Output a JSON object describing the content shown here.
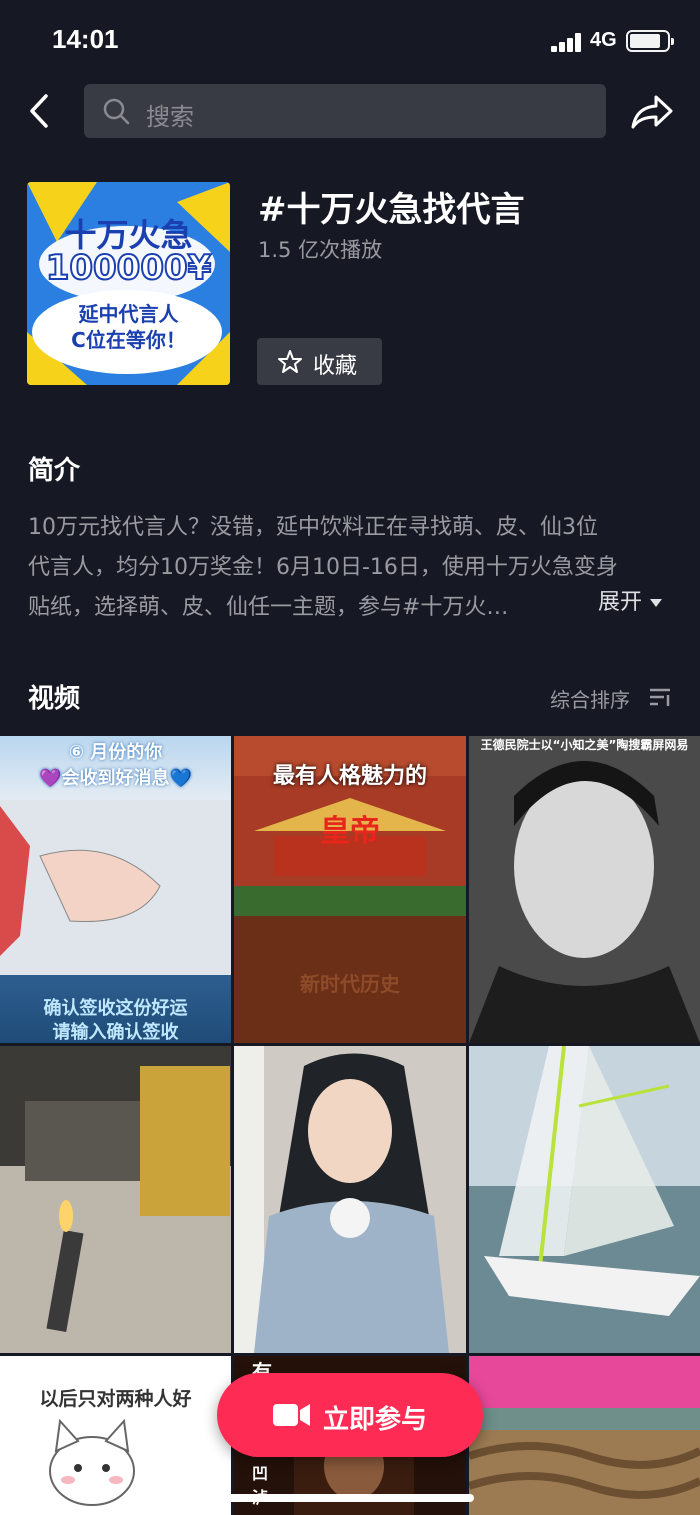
{
  "status_bar": {
    "time": "14:01",
    "network": "4G"
  },
  "search": {
    "placeholder": "搜索"
  },
  "topic": {
    "title": "#十万火急找代言",
    "plays": "1.5 亿次播放",
    "favorite_label": "收藏",
    "cover": {
      "line1": "十万火急",
      "line2": "100000¥",
      "line3": "延中代言人",
      "line4": "C位在等你！"
    }
  },
  "intro": {
    "heading": "简介",
    "lines": [
      "10万元找代言人？没错，延中饮料正在寻找萌、皮、仙3位",
      "代言人，均分10万奖金！6月10日-16日，使用十万火急变身",
      "贴纸，选择萌、皮、仙任一主题，参与#十万火…"
    ],
    "expand_label": "展开"
  },
  "videos": {
    "heading": "视频",
    "sort_label": "综合排序",
    "tiles": [
      {
        "caption_top": "⑥ 月份的你",
        "caption_top2": "💜会收到好消息💙",
        "caption_bottom": "确认签收这份好运",
        "caption_bottom2": "请输入确认签收"
      },
      {
        "caption_top": "最有人格魅力的",
        "caption_mid": "皇帝",
        "caption_bottom": "新时代历史"
      },
      {
        "caption_top": "王德民院士以“小知之美”陶搜霸屏网易"
      },
      {},
      {},
      {},
      {
        "caption_top": "以后只对两种人好"
      },
      {
        "caption_top": "有",
        "caption_bottom": "手加凹泸"
      },
      {}
    ]
  },
  "cta": {
    "label": "立即参与"
  },
  "colors": {
    "background": "#161823",
    "accent": "#fe2c55",
    "surface": "#393b44"
  }
}
